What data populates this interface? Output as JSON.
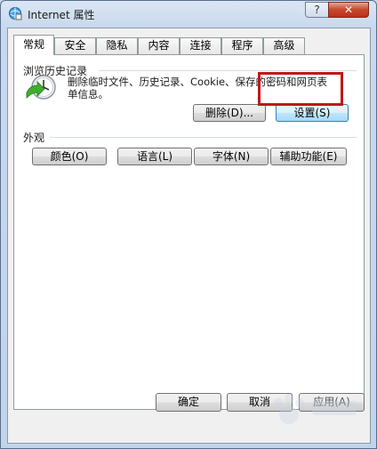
{
  "window": {
    "title": "Internet 属性",
    "help_label": "?",
    "close_label": "✕"
  },
  "tabs": [
    {
      "label": "常规",
      "active": true
    },
    {
      "label": "安全"
    },
    {
      "label": "隐私"
    },
    {
      "label": "内容"
    },
    {
      "label": "连接"
    },
    {
      "label": "程序"
    },
    {
      "label": "高级"
    }
  ],
  "history": {
    "group_title": "浏览历史记录",
    "description": "删除临时文件、历史记录、Cookie、保存的密码和网页表单信息。",
    "delete_label": "删除(D)...",
    "settings_label": "设置(S)"
  },
  "appearance": {
    "group_title": "外观",
    "colors_label": "颜色(O)",
    "languages_label": "语言(L)",
    "fonts_label": "字体(N)",
    "accessibility_label": "辅助功能(E)"
  },
  "footer": {
    "ok_label": "确定",
    "cancel_label": "取消",
    "apply_label": "应用(A)"
  },
  "colors": {
    "highlight": "#c0171a",
    "close_button": "#c9462c"
  }
}
